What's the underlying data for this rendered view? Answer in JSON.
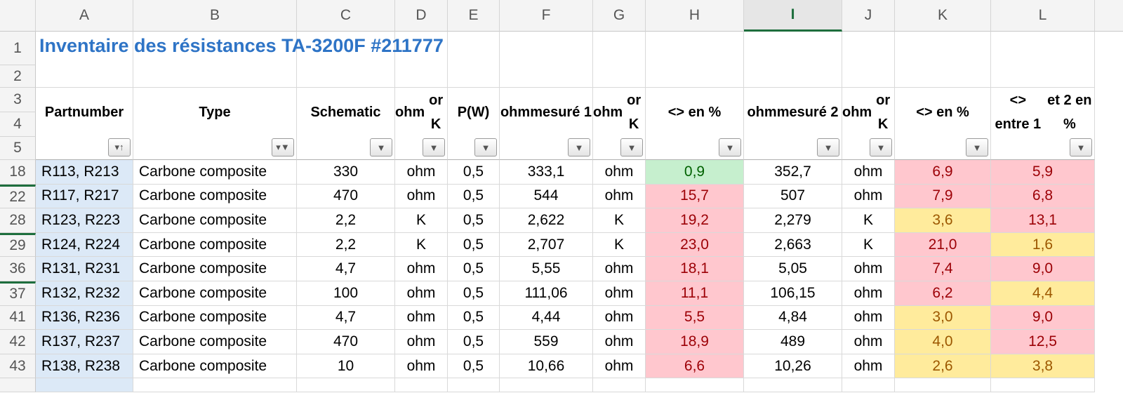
{
  "columns": [
    "A",
    "B",
    "C",
    "D",
    "E",
    "F",
    "G",
    "H",
    "I",
    "J",
    "K",
    "L"
  ],
  "selected_column": "I",
  "title": "Inventaire des résistances TA-3200F #211777",
  "header_row_numbers": [
    "1",
    "2",
    "3",
    "4",
    "5"
  ],
  "headers": [
    {
      "col": "A",
      "lines": [
        "Part",
        "number"
      ]
    },
    {
      "col": "B",
      "lines": [
        "Type"
      ]
    },
    {
      "col": "C",
      "lines": [
        "Schematic"
      ]
    },
    {
      "col": "D",
      "lines": [
        "ohm",
        "or K"
      ]
    },
    {
      "col": "E",
      "lines": [
        "P(W)"
      ]
    },
    {
      "col": "F",
      "lines": [
        "ohm",
        "mesuré 1"
      ]
    },
    {
      "col": "G",
      "lines": [
        "ohm",
        "or K"
      ]
    },
    {
      "col": "H",
      "lines": [
        "<> en %"
      ]
    },
    {
      "col": "I",
      "lines": [
        "ohm",
        "mesuré 2"
      ]
    },
    {
      "col": "J",
      "lines": [
        "ohm",
        "or K"
      ]
    },
    {
      "col": "K",
      "lines": [
        "<> en %"
      ]
    },
    {
      "col": "L",
      "lines": [
        "<> entre 1",
        "et 2 en %"
      ]
    }
  ],
  "filter_icons": {
    "A": "sort-ascending-filter-icon",
    "B": "active-filter-icon",
    "default": "dropdown-arrow-icon"
  },
  "colors": {
    "green_fill": "#c6efce",
    "red_fill": "#ffc7ce",
    "yellow_fill": "#ffeb9c",
    "title": "#2e74c6",
    "selected_header": "#1e6e3d"
  },
  "rows": [
    {
      "num": "18",
      "cells": [
        "R113, R213",
        "Carbone composite",
        "330",
        "ohm",
        "0,5",
        "333,1",
        "ohm",
        "0,9",
        "352,7",
        "ohm",
        "6,9",
        "5,9"
      ],
      "fmt": {
        "H": "green",
        "K": "red",
        "L": "red"
      }
    },
    {
      "num": "22",
      "cells": [
        "R117, R217",
        "Carbone composite",
        "470",
        "ohm",
        "0,5",
        "544",
        "ohm",
        "15,7",
        "507",
        "ohm",
        "7,9",
        "6,8"
      ],
      "fmt": {
        "H": "red",
        "K": "red",
        "L": "red"
      }
    },
    {
      "num": "28",
      "cells": [
        "R123, R223",
        "Carbone composite",
        "2,2",
        "K",
        "0,5",
        "2,622",
        "K",
        "19,2",
        "2,279",
        "K",
        "3,6",
        "13,1"
      ],
      "fmt": {
        "H": "red",
        "K": "yellow",
        "L": "red"
      }
    },
    {
      "num": "29",
      "cells": [
        "R124, R224",
        "Carbone composite",
        "2,2",
        "K",
        "0,5",
        "2,707",
        "K",
        "23,0",
        "2,663",
        "K",
        "21,0",
        "1,6"
      ],
      "fmt": {
        "H": "red",
        "K": "red",
        "L": "yellow"
      }
    },
    {
      "num": "36",
      "cells": [
        "R131, R231",
        "Carbone composite",
        "4,7",
        "ohm",
        "0,5",
        "5,55",
        "ohm",
        "18,1",
        "5,05",
        "ohm",
        "7,4",
        "9,0"
      ],
      "fmt": {
        "H": "red",
        "K": "red",
        "L": "red"
      }
    },
    {
      "num": "37",
      "cells": [
        "R132, R232",
        "Carbone composite",
        "100",
        "ohm",
        "0,5",
        "111,06",
        "ohm",
        "11,1",
        "106,15",
        "ohm",
        "6,2",
        "4,4"
      ],
      "fmt": {
        "H": "red",
        "K": "red",
        "L": "yellow"
      }
    },
    {
      "num": "41",
      "cells": [
        "R136, R236",
        "Carbone composite",
        "4,7",
        "ohm",
        "0,5",
        "4,44",
        "ohm",
        "5,5",
        "4,84",
        "ohm",
        "3,0",
        "9,0"
      ],
      "fmt": {
        "H": "red",
        "K": "yellow",
        "L": "red"
      }
    },
    {
      "num": "42",
      "cells": [
        "R137, R237",
        "Carbone composite",
        "470",
        "ohm",
        "0,5",
        "559",
        "ohm",
        "18,9",
        "489",
        "ohm",
        "4,0",
        "12,5"
      ],
      "fmt": {
        "H": "red",
        "K": "yellow",
        "L": "red"
      }
    },
    {
      "num": "43",
      "cells": [
        "R138, R238",
        "Carbone composite",
        "10",
        "ohm",
        "0,5",
        "10,66",
        "ohm",
        "6,6",
        "10,26",
        "ohm",
        "2,6",
        "3,8"
      ],
      "fmt": {
        "H": "red",
        "K": "yellow",
        "L": "yellow"
      }
    }
  ]
}
